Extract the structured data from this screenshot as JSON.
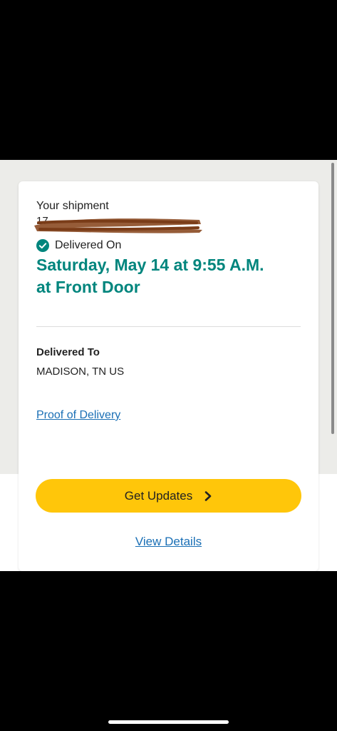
{
  "shipment": {
    "label": "Your shipment",
    "tracking_number_visible": "17"
  },
  "status": {
    "icon": "check-circle-icon",
    "label": "Delivered On",
    "datetime": "Saturday, May 14 at 9:55 A.M.",
    "location": "at Front Door"
  },
  "delivered_to": {
    "heading": "Delivered To",
    "address": "MADISON, TN US"
  },
  "links": {
    "proof_of_delivery": "Proof of Delivery",
    "view_details": "View Details"
  },
  "actions": {
    "get_updates": "Get Updates",
    "get_updates_icon": "chevron-right-icon"
  },
  "colors": {
    "accent_teal": "#00857d",
    "button_yellow": "#ffc60a",
    "link_blue": "#1a6fb5",
    "redaction_brown": "#8b4a22"
  }
}
